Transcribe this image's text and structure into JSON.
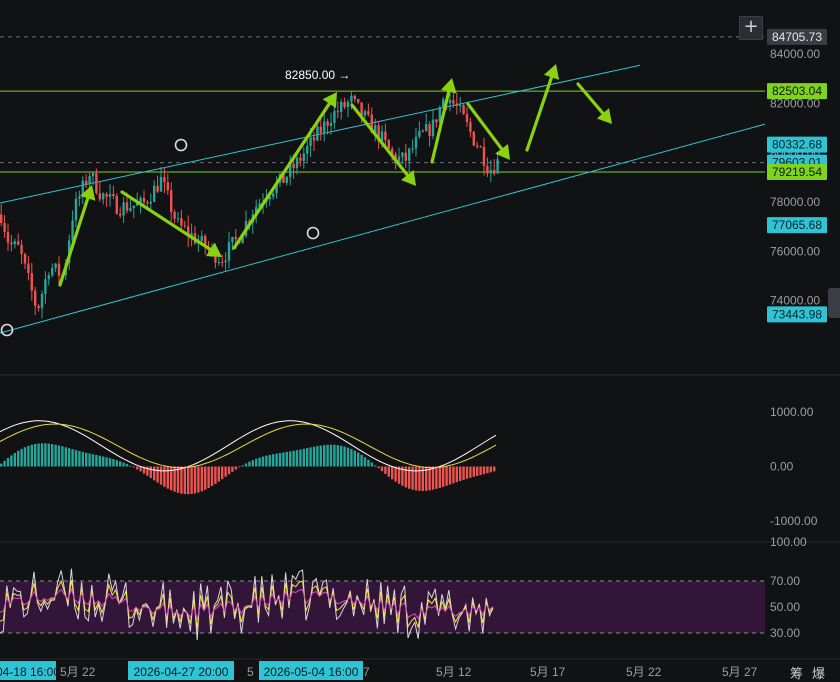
{
  "chart_data": [
    {
      "type": "candlestick",
      "title": "",
      "y_ticks": [
        84000,
        82000,
        80000,
        78000,
        76000,
        74000
      ],
      "y_tick_labels": [
        "84000.00",
        "82000.00",
        "80000.00",
        "78000.00",
        "76000.00",
        "74000.00"
      ],
      "ylim": [
        72200,
        86200
      ],
      "price_tags": [
        {
          "value": 84705.73,
          "label": "84705.73",
          "style": "gray"
        },
        {
          "value": 82503.04,
          "label": "82503.04",
          "style": "green"
        },
        {
          "value": 80332.68,
          "label": "80332.68",
          "style": "teal"
        },
        {
          "value": 79603.01,
          "label": "79603.01",
          "style": "teal"
        },
        {
          "value": 79219.54,
          "label": "79219.54",
          "style": "green"
        },
        {
          "value": 77065.68,
          "label": "77065.68",
          "style": "teal"
        },
        {
          "value": 73443.98,
          "label": "73443.98",
          "style": "teal"
        }
      ],
      "horizontal_lines": [
        {
          "value": 84705.73,
          "style": "dashed-gray"
        },
        {
          "value": 82503.04,
          "style": "solid-green"
        },
        {
          "value": 79603.01,
          "style": "dashed-gray"
        },
        {
          "value": 79219.54,
          "style": "solid-green"
        }
      ],
      "annotations": [
        {
          "label": "82850.00 →",
          "value": 82850.0
        }
      ],
      "close_path": [
        [
          "2026-04-17",
          77500
        ],
        [
          "2026-04-17 12:00",
          76300
        ],
        [
          "2026-04-18",
          76100
        ],
        [
          "2026-04-18 16:00",
          73600
        ],
        [
          "2026-04-19",
          75400
        ],
        [
          "2026-04-20",
          75000
        ],
        [
          "2026-04-21",
          77600
        ],
        [
          "2026-04-22",
          79200
        ],
        [
          "2026-04-23",
          78300
        ],
        [
          "2026-04-24",
          77800
        ],
        [
          "2026-04-25",
          77900
        ],
        [
          "2026-04-26",
          78900
        ],
        [
          "2026-04-27",
          77100
        ],
        [
          "2026-04-27 20:00",
          75700
        ],
        [
          "2026-04-28",
          76500
        ],
        [
          "2026-04-29",
          77700
        ],
        [
          "2026-04-30",
          78400
        ],
        [
          "2026-05-01",
          78900
        ],
        [
          "2026-05-02",
          79600
        ],
        [
          "2026-05-03",
          80500
        ],
        [
          "2026-05-04",
          81500
        ],
        [
          "2026-05-04 16:00",
          82100
        ],
        [
          "2026-05-05",
          81400
        ],
        [
          "2026-05-06",
          80600
        ],
        [
          "2026-05-07",
          79800
        ],
        [
          "2026-05-08",
          79700
        ],
        [
          "2026-05-09",
          80600
        ],
        [
          "2026-05-10",
          81100
        ],
        [
          "2026-05-11",
          82400
        ],
        [
          "2026-05-12",
          81700
        ],
        [
          "2026-05-13",
          80600
        ],
        [
          "2026-05-14",
          80100
        ],
        [
          "2026-05-14 18:00",
          79300
        ],
        [
          "2026-05-15",
          79700
        ]
      ]
    },
    {
      "type": "macd",
      "y_ticks": [
        1000,
        0,
        -1000
      ],
      "y_tick_labels": [
        "1000.00",
        "0.00",
        "-1000.00"
      ]
    },
    {
      "type": "rsi",
      "y_ticks": [
        100,
        70,
        50,
        30
      ],
      "y_tick_labels": [
        "100.00",
        "70.00",
        "50.00",
        "30.00"
      ],
      "band": [
        30,
        70
      ]
    }
  ],
  "x_axis": {
    "labels": [
      "5月 22",
      "5月 12",
      "5月 17",
      "5月 22",
      "5月 27"
    ],
    "highlights": [
      "04-18 16:00",
      "2026-04-27 20:00",
      "2026-05-04 16:00"
    ],
    "partial_labels": [
      "5",
      "7"
    ]
  },
  "corner_labels": [
    "筹",
    "爆"
  ],
  "toolbar": {
    "plus_label": "+"
  },
  "colors": {
    "up": "#26a69a",
    "down": "#ef5350",
    "channel": "#2ec4d6",
    "level": "#7ed321",
    "arrow": "#8ad10f",
    "macd": "#ffffff",
    "signal": "#e8d84a",
    "rsi_band": "#3a1640",
    "rsi_line": "#f2e24b"
  }
}
